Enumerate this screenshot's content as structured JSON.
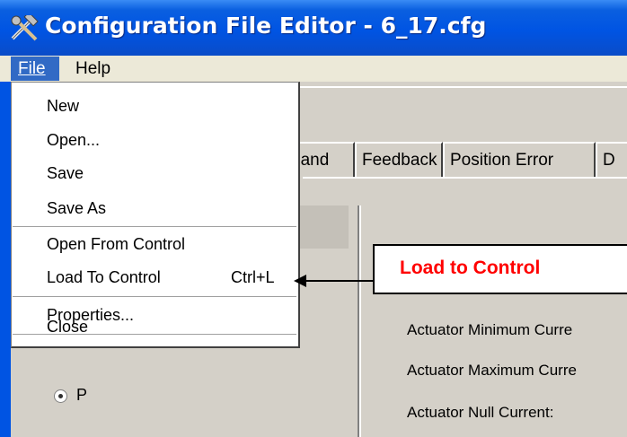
{
  "window": {
    "title": "Configuration File Editor - 6_17.cfg"
  },
  "menubar": {
    "file": "File",
    "help": "Help"
  },
  "file_menu": {
    "items": [
      {
        "label": "New"
      },
      {
        "label": "Open..."
      },
      {
        "label": "Save"
      },
      {
        "label": "Save As"
      },
      {
        "label": "Open From Control"
      },
      {
        "label": "Load To Control",
        "shortcut": "Ctrl+L"
      },
      {
        "label": "Properties..."
      },
      {
        "label": "Close"
      }
    ]
  },
  "tabs": [
    "nand",
    "Feedback",
    "Position Error",
    "D"
  ],
  "fields": [
    "Actuator Minimum Curre",
    "Actuator Maximum Curre",
    "Actuator Null Current:"
  ],
  "radio": {
    "label": "P"
  },
  "callout": {
    "text": "Load to Control"
  },
  "colors": {
    "titlebar": "#0054e3",
    "menu_highlight": "#316ac5",
    "callout_text": "#ff0000"
  },
  "icons": {
    "app": "tools-icon",
    "arrow": "arrow-left-icon"
  }
}
